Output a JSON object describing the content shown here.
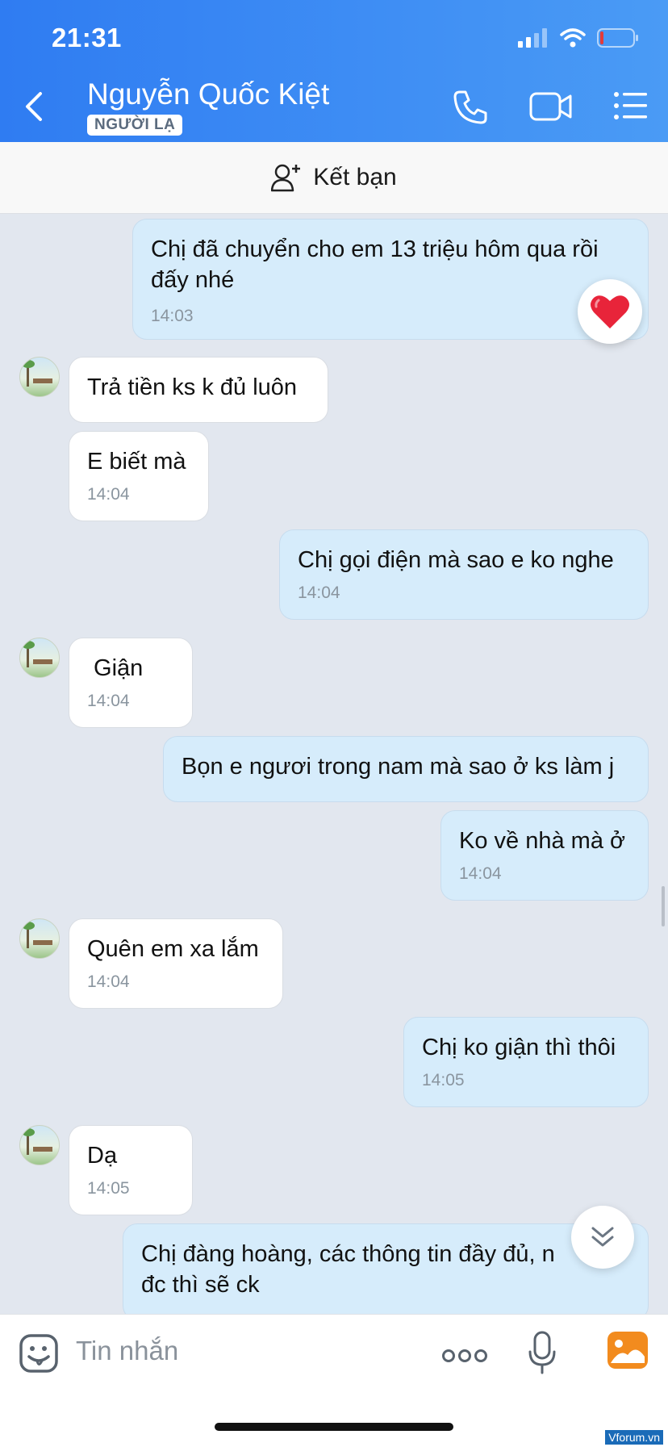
{
  "status_bar": {
    "time": "21:31"
  },
  "header": {
    "title": "Nguyễn Quốc Kiệt",
    "badge": "NGƯỜI LẠ"
  },
  "add_friend": {
    "label": "Kết bạn"
  },
  "messages": [
    {
      "dir": "out",
      "lines": [
        "Chị đã chuyển cho em 13 triệu hôm qua rồi",
        "đấy nhé"
      ],
      "time": "14:03",
      "reaction": "heart"
    },
    {
      "dir": "in",
      "text": "Trả tiền ks k đủ luôn",
      "time": ""
    },
    {
      "dir": "in",
      "text": "E biết mà",
      "time": "14:04"
    },
    {
      "dir": "out",
      "text": "Chị gọi điện mà sao e ko nghe",
      "time": "14:04"
    },
    {
      "dir": "in",
      "text": " Giận",
      "time": "14:04"
    },
    {
      "dir": "out",
      "text": "Bọn e ngươi trong nam mà sao ở ks làm j",
      "time": ""
    },
    {
      "dir": "out",
      "text": "Ko về nhà mà ở",
      "time": "14:04"
    },
    {
      "dir": "in",
      "text": "Quên em xa lắm",
      "time": "14:04"
    },
    {
      "dir": "out",
      "text": "Chị ko giận thì thôi",
      "time": "14:05"
    },
    {
      "dir": "in",
      "text": "Dạ",
      "time": "14:05"
    },
    {
      "dir": "out",
      "lines": [
        "Chị đàng hoàng, các thông tin đầy đủ, n",
        "đc thì sẽ ck"
      ],
      "time": ""
    }
  ],
  "input": {
    "placeholder": "Tin nhắn"
  },
  "watermark": "Vforum.vn",
  "colors": {
    "header_start": "#2f7cf2",
    "header_end": "#4a9bf5",
    "outgoing_bubble": "#d6ecfb",
    "incoming_bubble": "#ffffff",
    "chat_bg": "#e2e7ef"
  }
}
